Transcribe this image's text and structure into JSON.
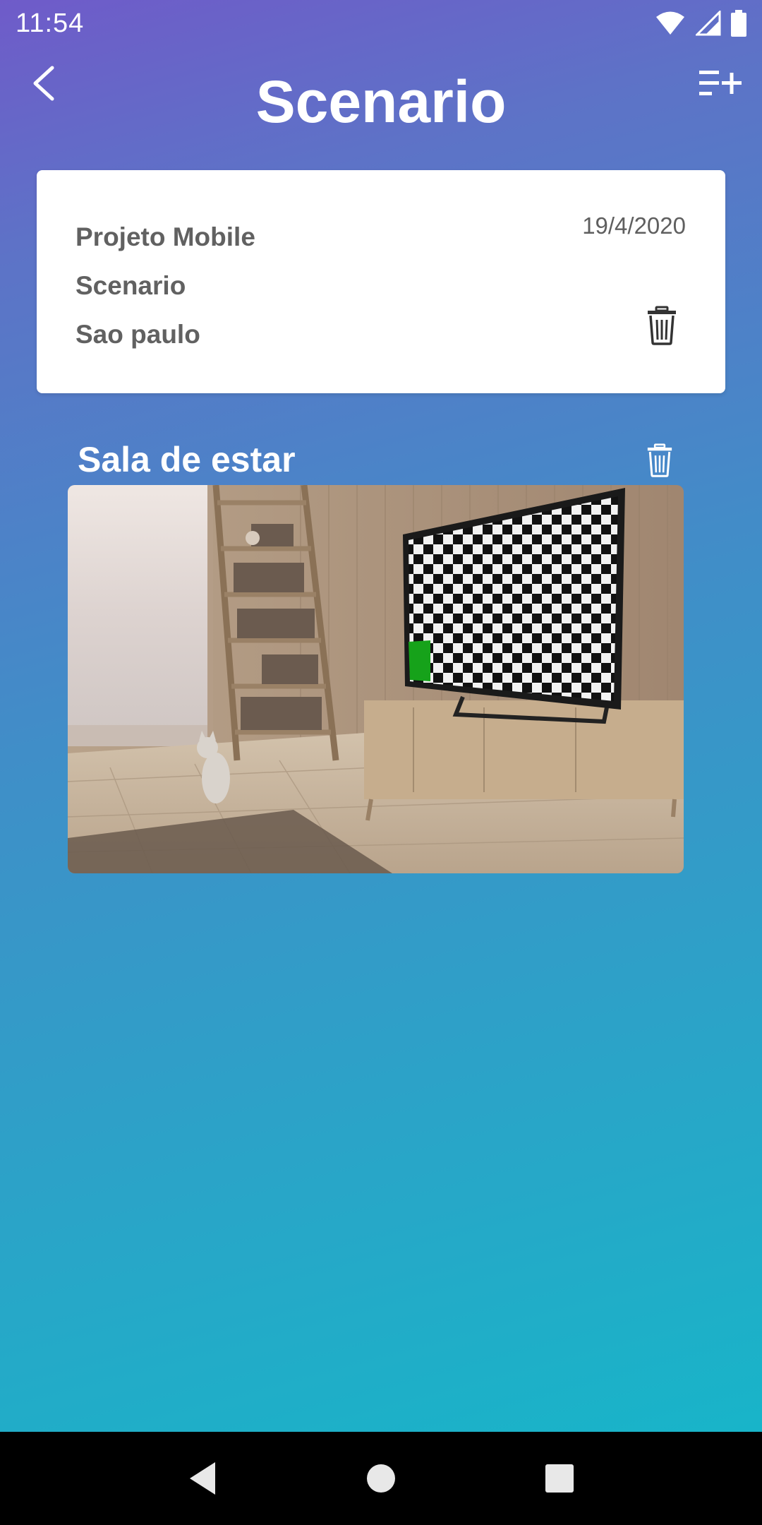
{
  "status_bar": {
    "time": "11:54",
    "icons": [
      "wifi-icon",
      "signal-icon",
      "battery-icon"
    ]
  },
  "header": {
    "title": "Scenario",
    "back_icon": "back-arrow-icon",
    "action_icon": "playlist-add-icon"
  },
  "project": {
    "name": "Projeto Mobile",
    "type": "Scenario",
    "location": "Sao paulo",
    "date": "19/4/2020",
    "delete_icon": "trash-icon"
  },
  "rooms": [
    {
      "title": "Sala de estar",
      "delete_icon": "trash-icon",
      "image": "living-room-photo"
    }
  ],
  "nav_bar": {
    "buttons": [
      "back-triangle-icon",
      "home-circle-icon",
      "recents-square-icon"
    ]
  },
  "colors": {
    "gradient_top": "#6f5bc9",
    "gradient_bottom": "#14b8c9",
    "card_text": "#616161",
    "nav_bar": "#000000"
  }
}
